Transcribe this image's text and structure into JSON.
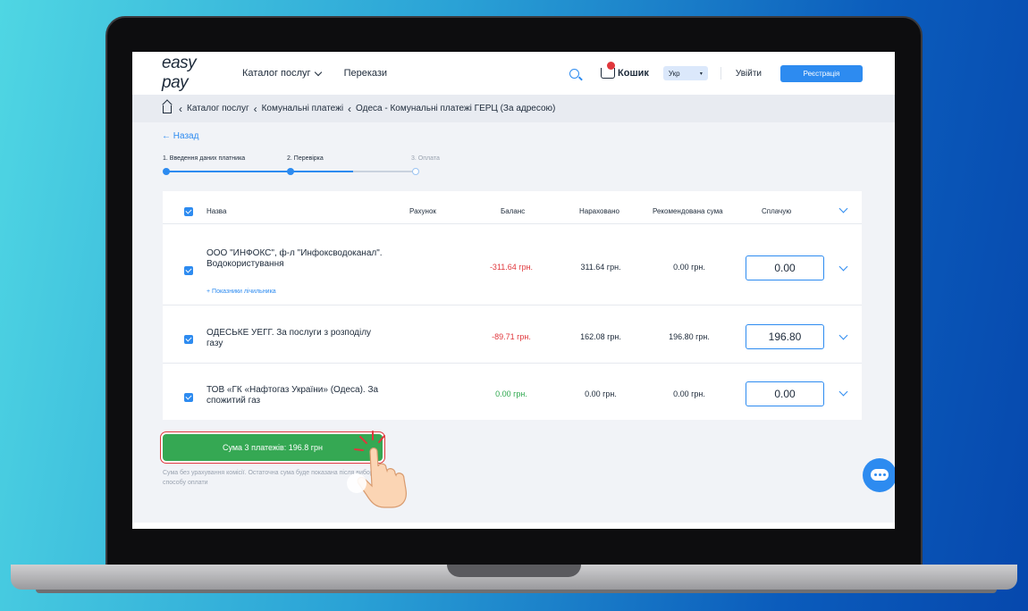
{
  "header": {
    "logo": "easy pay",
    "nav": [
      {
        "label": "Каталог послуг"
      },
      {
        "label": "Перекази"
      }
    ],
    "cart_label": "Кошик",
    "cart_count": "",
    "lang": "Укр",
    "login": "Увійти",
    "register": "Реєстрація"
  },
  "breadcrumbs": [
    "Каталог послуг",
    "Комунальні платежі",
    "Одеса - Комунальні платежі ГЕРЦ (За адресою)"
  ],
  "back": "← Назад",
  "steps": [
    {
      "label": "1. Введення даних платника",
      "state": "done"
    },
    {
      "label": "2. Перевірка",
      "state": "active"
    },
    {
      "label": "3. Оплата",
      "state": "pending"
    }
  ],
  "table": {
    "headers": {
      "name": "Назва",
      "account": "Рахунок",
      "balance": "Баланс",
      "accrued": "Нараховано",
      "recommended": "Рекомендована сума",
      "paying": "Сплачую"
    },
    "rows": [
      {
        "name": "ООО \"ИНФОКС\", ф-л \"Инфоксводоканал\". Водокористування",
        "meter_link": "+ Показники лічильника",
        "balance": "-311.64 грн.",
        "accrued": "311.64 грн.",
        "recommended": "0.00 грн.",
        "paying": "0.00"
      },
      {
        "name": "ОДЕСЬКЕ УЕГГ. За послуги з розподілу газу",
        "balance": "-89.71 грн.",
        "accrued": "162.08 грн.",
        "recommended": "196.80 грн.",
        "paying": "196.80"
      },
      {
        "name": "ТОВ «ГК «Нафтогаз України» (Одеса). За спожитий газ",
        "balance": "0.00 грн.",
        "accrued": "0.00 грн.",
        "recommended": "0.00 грн.",
        "paying": "0.00"
      }
    ]
  },
  "sum_button": "Сума 3 платежів: 196.8 грн",
  "note": "Сума без урахування комісії. Остаточна сума буде показана після вибору способу оплати",
  "colors": {
    "accent": "#2d8bf0",
    "negative": "#e0373c",
    "positive": "#2fa84f",
    "button": "#35a853"
  }
}
